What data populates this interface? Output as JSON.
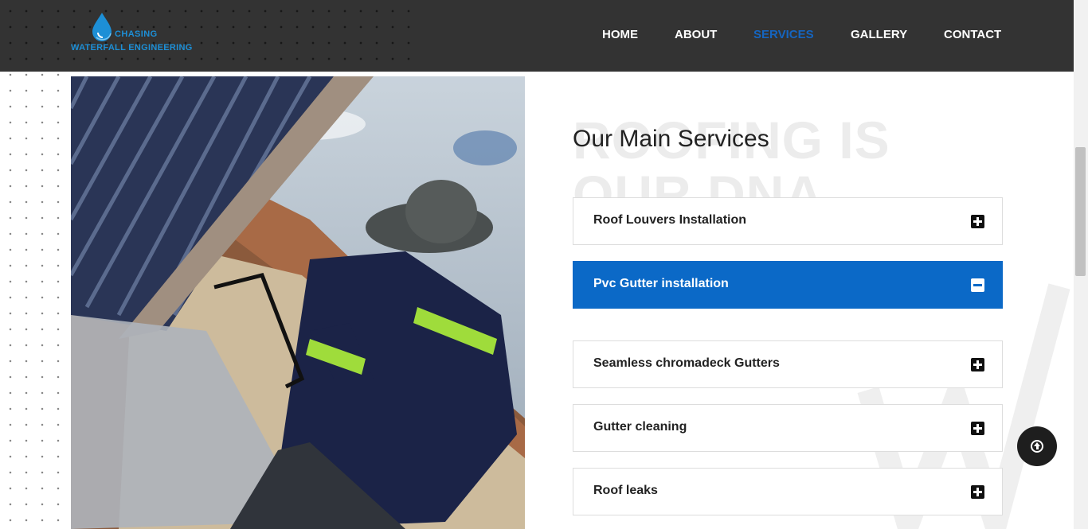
{
  "brand": {
    "line1": "CHASING",
    "line2": "WATERFALL ENGINEERING",
    "color": "#1d8fd6"
  },
  "nav": {
    "items": [
      {
        "label": "HOME",
        "active": false
      },
      {
        "label": "ABOUT",
        "active": false
      },
      {
        "label": "SERVICES",
        "active": true
      },
      {
        "label": "GALLERY",
        "active": false
      },
      {
        "label": "CONTACT",
        "active": false
      }
    ],
    "active_color": "#1565c0"
  },
  "services": {
    "background_text_line1": "ROOFING IS",
    "background_text_line2": "OUR DNA",
    "title": "Our Main Services",
    "items": [
      {
        "label": "Roof Louvers Installation",
        "expanded": false,
        "icon": "plus-square-icon"
      },
      {
        "label": "Pvc Gutter installation",
        "expanded": true,
        "icon": "minus-square-icon"
      },
      {
        "label": "Seamless chromadeck Gutters",
        "expanded": false,
        "icon": "plus-square-icon"
      },
      {
        "label": "Gutter cleaning",
        "expanded": false,
        "icon": "plus-square-icon"
      },
      {
        "label": "Roof leaks",
        "expanded": false,
        "icon": "plus-square-icon"
      }
    ],
    "accent_color": "#0b69c7"
  },
  "scroll_top": {
    "icon": "arrow-up-circle-icon"
  }
}
